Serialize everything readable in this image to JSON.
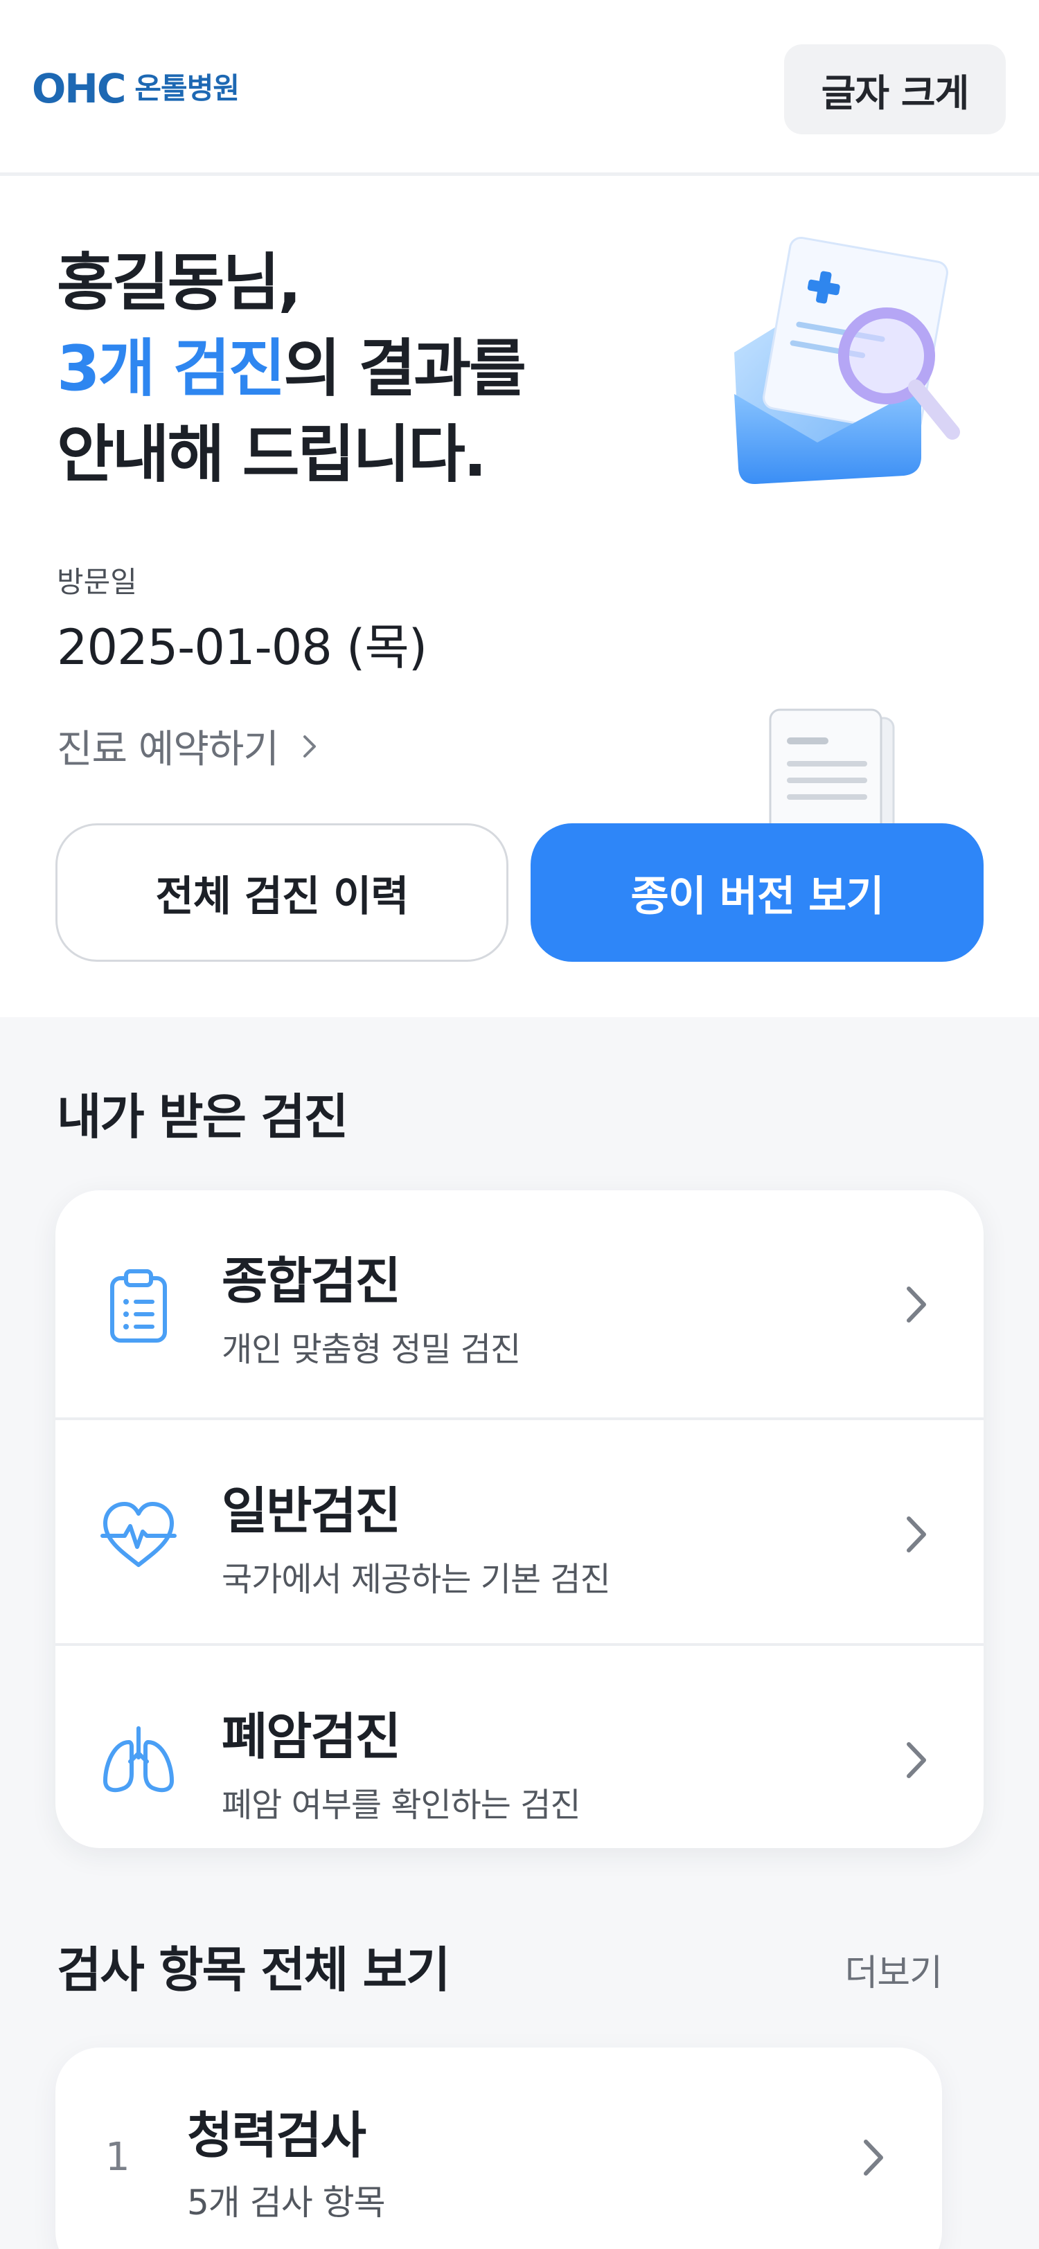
{
  "header": {
    "logo_mark": "OHC",
    "logo_name": "온톨병원",
    "font_size_button": "글자 크게"
  },
  "hero": {
    "headline_line1": "홍길동님,",
    "headline_accent": "3개 검진",
    "headline_line2_rest": "의 결과를",
    "headline_line3": "안내해 드립니다.",
    "visit_label": "방문일",
    "visit_date": "2025-01-08  (목)",
    "reserve_link": "진료 예약하기",
    "btn_history": "전체 검진 이력",
    "btn_paper": "종이 버전 보기"
  },
  "my_checkups": {
    "title": "내가 받은 검진",
    "items": [
      {
        "title": "종합검진",
        "subtitle": "개인 맞춤형 정밀 검진",
        "icon": "clipboard-icon"
      },
      {
        "title": "일반검진",
        "subtitle": "국가에서 제공하는 기본 검진",
        "icon": "heartbeat-icon"
      },
      {
        "title": "폐암검진",
        "subtitle": "폐암 여부를 확인하는 검진",
        "icon": "lungs-icon"
      }
    ]
  },
  "test_items": {
    "title": "검사 항목 전체 보기",
    "more": "더보기",
    "items": [
      {
        "num": "1",
        "title": "청력검사",
        "subtitle": "5개 검사 항목"
      }
    ]
  },
  "colors": {
    "accent": "#2e86f0",
    "logo": "#1d68b3",
    "icon_blue": "#4a9ff5"
  }
}
